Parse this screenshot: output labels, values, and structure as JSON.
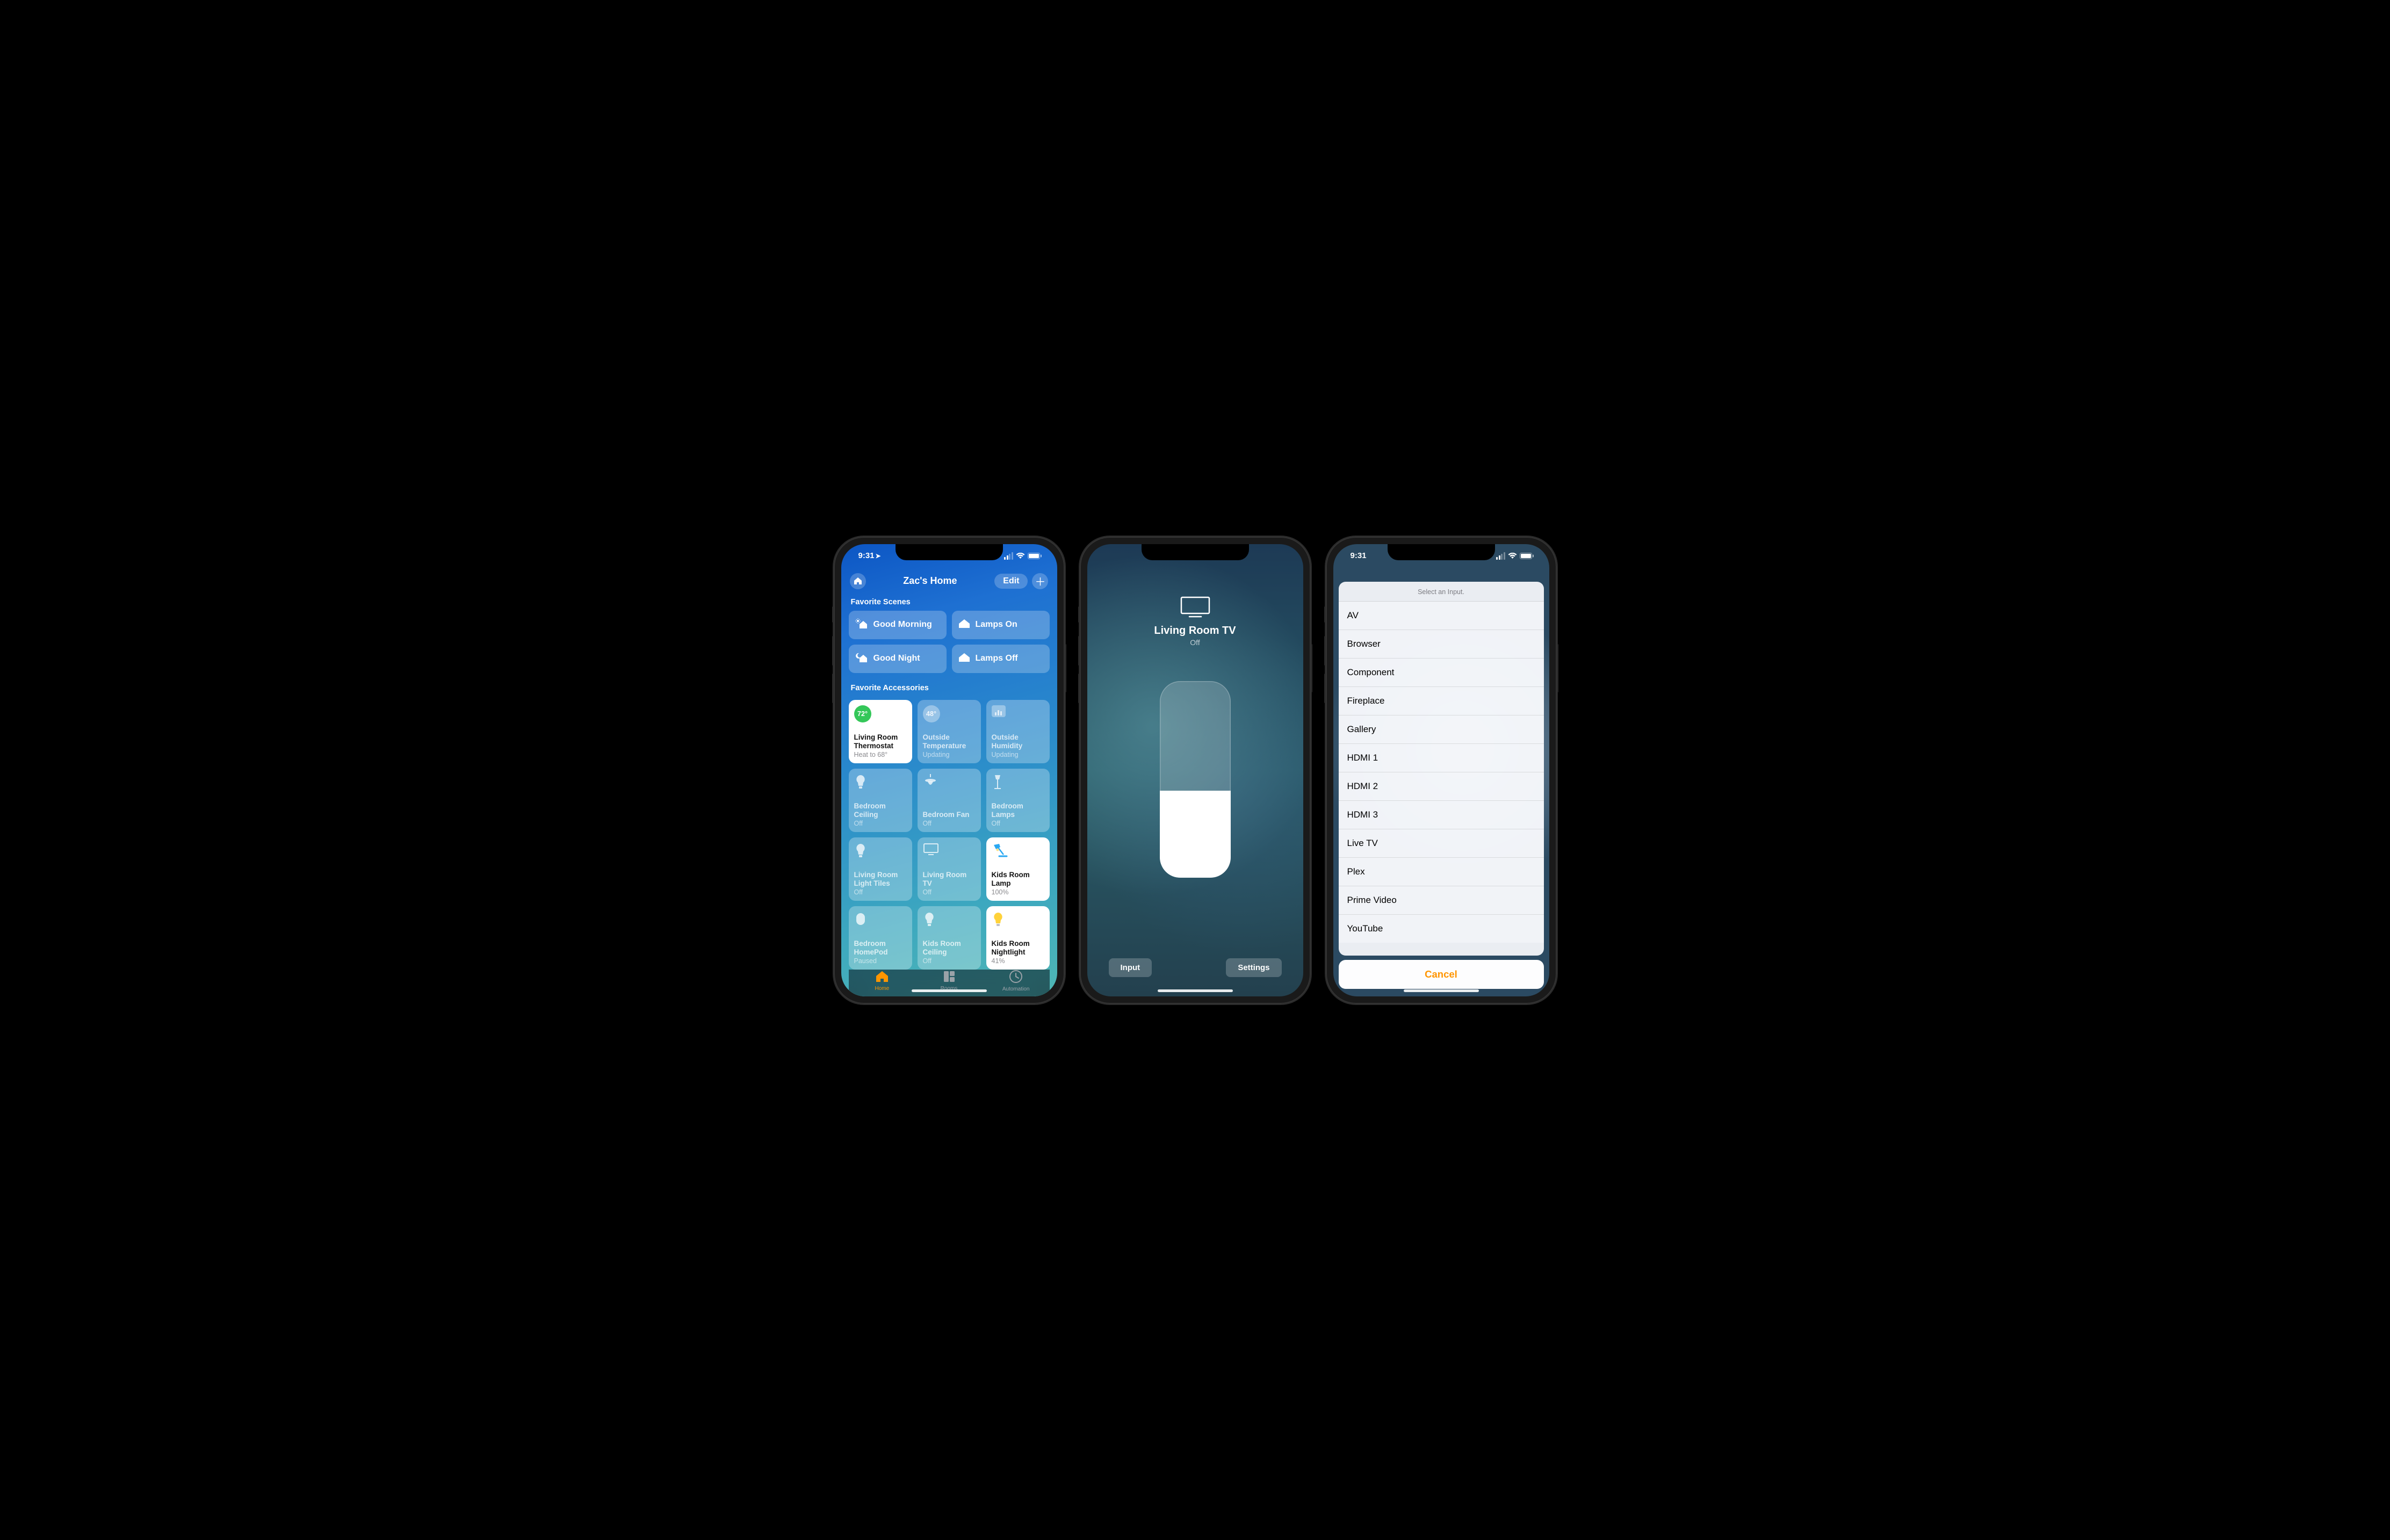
{
  "status": {
    "time": "9:31",
    "location_arrow": true
  },
  "screen1": {
    "title": "Zac's Home",
    "edit": "Edit",
    "sections": {
      "scenes": "Favorite Scenes",
      "accessories": "Favorite Accessories"
    },
    "scenes": [
      {
        "label": "Good Morning",
        "icon": "sun-house"
      },
      {
        "label": "Lamps On",
        "icon": "house"
      },
      {
        "label": "Good Night",
        "icon": "moon-house"
      },
      {
        "label": "Lamps Off",
        "icon": "house"
      }
    ],
    "tiles": [
      {
        "name": "Living Room Thermostat",
        "sub": "Heat to 68°",
        "value": "72°",
        "on": true,
        "kind": "temp-green"
      },
      {
        "name": "Outside Temperature",
        "sub": "Updating",
        "value": "48°",
        "on": false,
        "kind": "temp-grey"
      },
      {
        "name": "Outside Humidity",
        "sub": "Updating",
        "value": "",
        "on": false,
        "kind": "humidity"
      },
      {
        "name": "Bedroom Ceiling",
        "sub": "Off",
        "on": false,
        "kind": "bulb"
      },
      {
        "name": "Bedroom Fan",
        "sub": "Off",
        "on": false,
        "kind": "fan"
      },
      {
        "name": "Bedroom Lamps",
        "sub": "Off",
        "on": false,
        "kind": "floor-lamp"
      },
      {
        "name": "Living Room Light Tiles",
        "sub": "Off",
        "on": false,
        "kind": "bulb"
      },
      {
        "name": "Living Room TV",
        "sub": "Off",
        "on": false,
        "kind": "tv"
      },
      {
        "name": "Kids Room Lamp",
        "sub": "100%",
        "on": true,
        "kind": "desk-lamp",
        "color": "#2aa8f2"
      },
      {
        "name": "Bedroom HomePod",
        "sub": "Paused",
        "on": false,
        "kind": "homepod"
      },
      {
        "name": "Kids Room Ceiling",
        "sub": "Off",
        "on": false,
        "kind": "bulb"
      },
      {
        "name": "Kids Room Nightlight",
        "sub": "41%",
        "on": true,
        "kind": "bulb-on",
        "color": "#ffd23a"
      }
    ],
    "tabs": [
      {
        "label": "Home",
        "active": true
      },
      {
        "label": "Rooms",
        "active": false
      },
      {
        "label": "Automation",
        "active": false
      }
    ]
  },
  "screen2": {
    "name": "Living Room TV",
    "state": "Off",
    "buttons": {
      "input": "Input",
      "settings": "Settings"
    }
  },
  "screen3": {
    "header": "Select an Input.",
    "options": [
      "AV",
      "Browser",
      "Component",
      "Fireplace",
      "Gallery",
      "HDMI 1",
      "HDMI 2",
      "HDMI 3",
      "Live TV",
      "Plex",
      "Prime Video",
      "YouTube"
    ],
    "cancel": "Cancel"
  }
}
